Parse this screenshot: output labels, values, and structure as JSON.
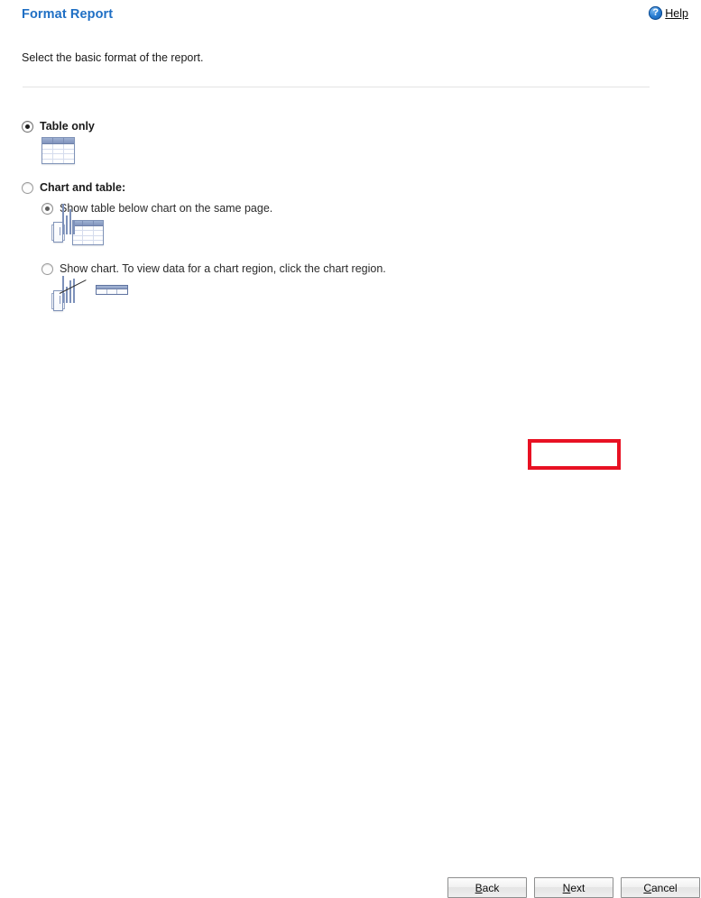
{
  "header": {
    "title": "Format Report",
    "help_label": "Help",
    "help_icon": "help-question-circle-icon"
  },
  "description": "Select the basic format of the report.",
  "options": [
    {
      "id": "table-only",
      "label": "Table only",
      "selected": true,
      "icon": "table-grid-icon"
    },
    {
      "id": "chart-and-table",
      "label": "Chart and table:",
      "selected": false,
      "sub_options": [
        {
          "id": "table-below-chart",
          "label": "Show table below chart on the same page.",
          "selected": true,
          "icons": [
            "bar-chart-icon",
            "table-grid-icon"
          ]
        },
        {
          "id": "show-chart-drilldown",
          "label": "Show chart. To view data for a chart region, click the chart region.",
          "selected": false,
          "icons": [
            "bar-chart-icon",
            "leader-line-icon",
            "tooltip-grid-icon"
          ]
        }
      ]
    }
  ],
  "footer": {
    "buttons": [
      {
        "id": "back",
        "accel": "B",
        "rest": "ack"
      },
      {
        "id": "next",
        "accel": "N",
        "rest": "ext"
      },
      {
        "id": "cancel",
        "accel": "C",
        "rest": "ancel"
      }
    ]
  },
  "annotation": {
    "target": "next-button",
    "color": "#e81123"
  },
  "chart_icon_data": {
    "type": "bar",
    "bars_variant_a": [
      34,
      21,
      28,
      16
    ],
    "bars_variant_b": [
      30,
      18,
      25,
      27
    ]
  }
}
